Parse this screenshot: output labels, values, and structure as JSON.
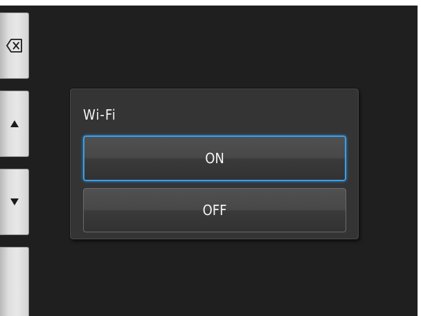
{
  "side_keys": {
    "backspace_icon": "backspace-icon",
    "up_icon": "up-triangle-icon",
    "down_icon": "down-triangle-icon"
  },
  "dialog": {
    "title": "Wi-Fi",
    "options": [
      {
        "label": "ON",
        "selected": true
      },
      {
        "label": "OFF",
        "selected": false
      }
    ]
  },
  "colors": {
    "background": "#1f1f1f",
    "dialog": "#343434",
    "selection_outline": "#3a9ee8",
    "text": "#f4f4f4"
  }
}
